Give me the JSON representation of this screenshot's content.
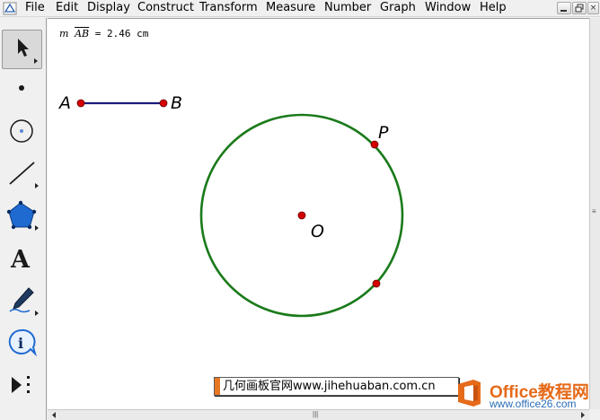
{
  "menu": {
    "items": [
      "File",
      "Edit",
      "Display",
      "Construct",
      "Transform",
      "Measure",
      "Number",
      "Graph",
      "Window",
      "Help"
    ]
  },
  "window_controls": {
    "minimize_icon": "minimize-icon",
    "restore_icon": "restore-icon",
    "close_glyph": "×"
  },
  "toolbox": {
    "tools": [
      {
        "name": "arrow-tool",
        "icon": "arrow-icon",
        "selected": true
      },
      {
        "name": "point-tool",
        "icon": "point-icon"
      },
      {
        "name": "compass-tool",
        "icon": "compass-icon"
      },
      {
        "name": "straightedge-tool",
        "icon": "straightedge-icon"
      },
      {
        "name": "polygon-tool",
        "icon": "polygon-icon"
      },
      {
        "name": "text-tool",
        "icon": "text-icon",
        "glyph": "A"
      },
      {
        "name": "marker-tool",
        "icon": "marker-icon"
      },
      {
        "name": "information-tool",
        "icon": "info-icon",
        "glyph": "i"
      },
      {
        "name": "custom-tools",
        "icon": "custom-tools-icon"
      }
    ]
  },
  "canvas": {
    "measurement": {
      "prefix": "m",
      "segment": "AB",
      "value": "= 2.46 cm"
    },
    "points": {
      "A": "A",
      "B": "B",
      "O": "O",
      "P": "P"
    },
    "colors": {
      "segment": "#1a1a7a",
      "circle": "#1a7a1a",
      "point_fill": "#d40000"
    }
  },
  "watermark": {
    "banner_text": "几何画板官网www.jihehuaban.com.cn",
    "logo_title": "Office教程网",
    "logo_url": "www.office26.com",
    "logo_color": "#e56a1a"
  }
}
